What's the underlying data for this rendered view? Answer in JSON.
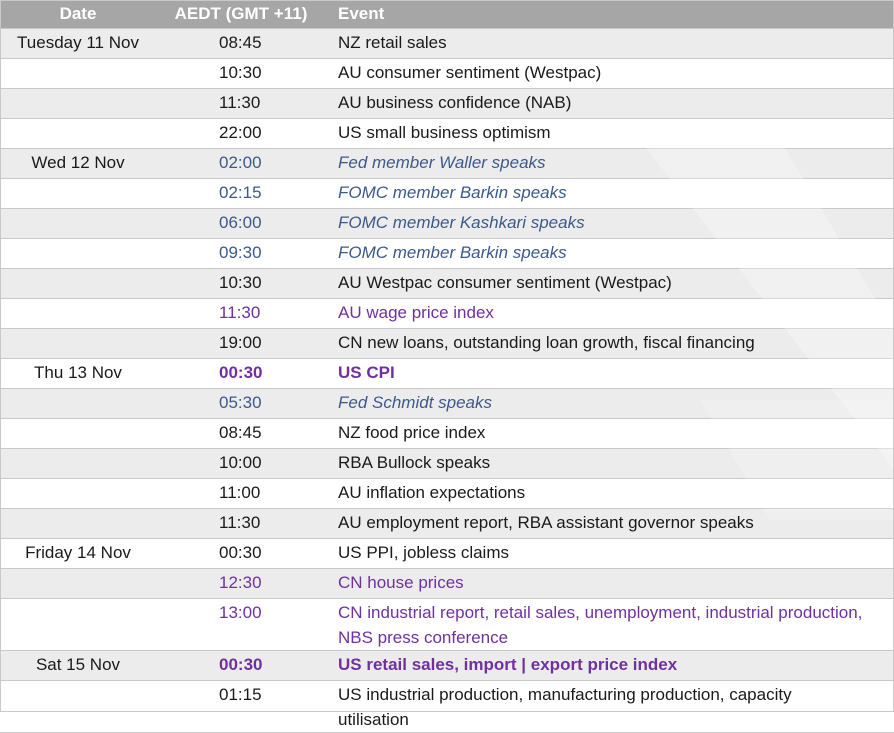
{
  "columns": {
    "date": "Date",
    "time": "AEDT (GMT +11)",
    "event": "Event"
  },
  "rows": [
    {
      "date": "Tuesday 11 Nov",
      "time": "08:45",
      "event": "NZ retail sales",
      "style": "normal",
      "shaded": true
    },
    {
      "date": "",
      "time": "10:30",
      "event": "AU consumer sentiment (Westpac)",
      "style": "normal",
      "shaded": false
    },
    {
      "date": "",
      "time": "11:30",
      "event": "AU business confidence (NAB)",
      "style": "normal",
      "shaded": true
    },
    {
      "date": "",
      "time": "22:00",
      "event": "US small business optimism",
      "style": "normal",
      "shaded": false
    },
    {
      "date": "Wed 12 Nov",
      "time": "02:00",
      "event": "Fed member Waller speaks",
      "style": "blue-italic",
      "shaded": true
    },
    {
      "date": "",
      "time": "02:15",
      "event": "FOMC member Barkin speaks",
      "style": "blue-italic",
      "shaded": false
    },
    {
      "date": "",
      "time": "06:00",
      "event": "FOMC member Kashkari speaks",
      "style": "blue-italic",
      "shaded": true
    },
    {
      "date": "",
      "time": "09:30",
      "event": "FOMC member Barkin speaks",
      "style": "blue-italic",
      "shaded": false
    },
    {
      "date": "",
      "time": "10:30",
      "event": "AU Westpac consumer sentiment (Westpac)",
      "style": "normal",
      "shaded": true
    },
    {
      "date": "",
      "time": "11:30",
      "event": "AU wage price index",
      "style": "purple",
      "shaded": false
    },
    {
      "date": "",
      "time": "19:00",
      "event": "CN new loans, outstanding loan growth, fiscal financing",
      "style": "normal",
      "shaded": true
    },
    {
      "date": "Thu 13 Nov",
      "time": "00:30",
      "event": "US CPI",
      "style": "purple-bold",
      "shaded": false
    },
    {
      "date": "",
      "time": "05:30",
      "event": "Fed Schmidt speaks",
      "style": "blue-italic",
      "shaded": true
    },
    {
      "date": "",
      "time": "08:45",
      "event": "NZ food price index",
      "style": "normal",
      "shaded": false
    },
    {
      "date": "",
      "time": "10:00",
      "event": "RBA Bullock speaks",
      "style": "normal",
      "shaded": true
    },
    {
      "date": "",
      "time": "11:00",
      "event": "AU inflation expectations",
      "style": "normal",
      "shaded": false
    },
    {
      "date": "",
      "time": "11:30",
      "event": "AU employment report, RBA assistant governor speaks",
      "style": "normal",
      "shaded": true
    },
    {
      "date": "Friday 14 Nov",
      "time": "00:30",
      "event": "US PPI, jobless claims",
      "style": "normal",
      "shaded": false
    },
    {
      "date": "",
      "time": "12:30",
      "event": "CN house prices",
      "style": "purple",
      "shaded": true
    },
    {
      "date": "",
      "time": "13:00",
      "event": "CN industrial report, retail sales, unemployment, industrial production, NBS press conference",
      "style": "purple",
      "shaded": false,
      "tall": true
    },
    {
      "date": "Sat 15 Nov",
      "time": "00:30",
      "event": "US retail sales, import | export price index",
      "style": "purple-bold",
      "shaded": true
    },
    {
      "date": "",
      "time": "01:15",
      "event": "US industrial production, manufacturing production, capacity utilisation",
      "style": "normal",
      "shaded": false,
      "tall": true
    }
  ],
  "colors": {
    "header_bg": "#a6a6a6",
    "shaded_row": "#ececec",
    "blue_text": "#3b5a8c",
    "purple_text": "#7030a0"
  }
}
